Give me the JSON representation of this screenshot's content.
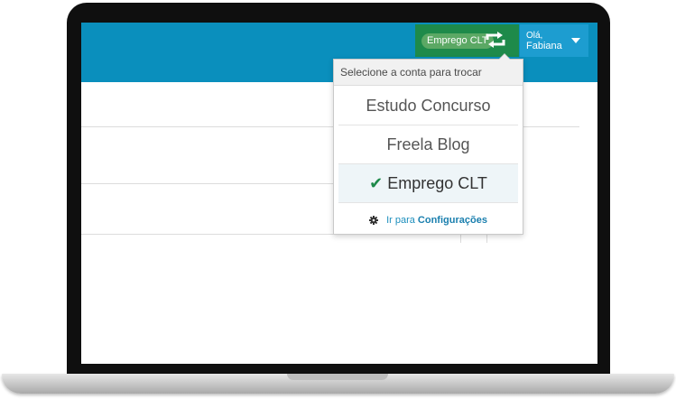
{
  "header": {
    "current_account": "Emprego CLT",
    "greeting": "Olá,",
    "user_name": "Fabiana"
  },
  "dropdown": {
    "title": "Selecione a conta para trocar",
    "accounts": [
      "Estudo Concurso",
      "Freela Blog",
      "Emprego CLT"
    ],
    "active_account": "Emprego CLT",
    "footer_prefix": "Ir para",
    "footer_link": "Configurações"
  },
  "colors": {
    "header_bg": "#0a8fbd",
    "switch_bg": "#1e8a4a",
    "user_bg": "#1d9dd0",
    "link": "#1a7fae"
  }
}
